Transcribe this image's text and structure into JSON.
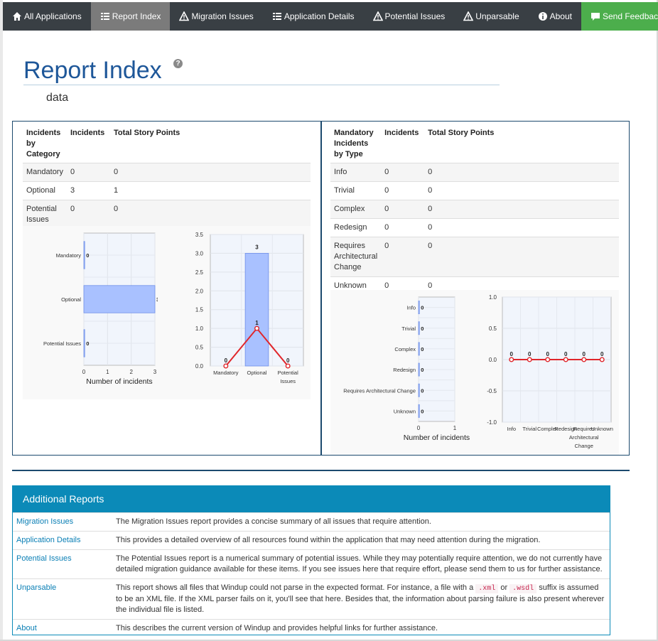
{
  "nav": {
    "items": [
      {
        "label": "All Applications",
        "icon": "home-icon"
      },
      {
        "label": "Report Index",
        "icon": "list-icon",
        "active": true
      },
      {
        "label": "Migration Issues",
        "icon": "warning-icon"
      },
      {
        "label": "Application Details",
        "icon": "list-icon"
      },
      {
        "label": "Potential Issues",
        "icon": "warning-icon"
      },
      {
        "label": "Unparsable",
        "icon": "warning-icon"
      },
      {
        "label": "About",
        "icon": "info-icon"
      }
    ],
    "feedback": {
      "label": "Send Feedback",
      "icon": "comment-icon"
    },
    "colors": {
      "bar": "#393f44",
      "active": "#7b7b7b",
      "feedback": "#4cae4c"
    }
  },
  "page": {
    "title": "Report Index",
    "help_glyph": "?",
    "app_name": "data",
    "title_color": "#1e5799"
  },
  "category_table": {
    "headers": [
      "Incidents by Category",
      "Incidents",
      "Total Story Points"
    ],
    "rows": [
      {
        "name": "Mandatory",
        "incidents": "0",
        "points": "0"
      },
      {
        "name": "Optional",
        "incidents": "3",
        "points": "1"
      },
      {
        "name": "Potential Issues",
        "incidents": "0",
        "points": "0"
      }
    ]
  },
  "type_table": {
    "headers": [
      "Mandatory Incidents by Type",
      "Incidents",
      "Total Story Points"
    ],
    "rows": [
      {
        "name": "Info",
        "incidents": "0",
        "points": "0"
      },
      {
        "name": "Trivial",
        "incidents": "0",
        "points": "0"
      },
      {
        "name": "Complex",
        "incidents": "0",
        "points": "0"
      },
      {
        "name": "Redesign",
        "incidents": "0",
        "points": "0"
      },
      {
        "name": "Requires Architectural Change",
        "incidents": "0",
        "points": "0"
      },
      {
        "name": "Unknown",
        "incidents": "0",
        "points": "0"
      }
    ]
  },
  "chart_data": [
    {
      "type": "bar",
      "orientation": "horizontal",
      "categories": [
        "Mandatory",
        "Optional",
        "Potential Issues"
      ],
      "values": [
        0,
        3,
        0
      ],
      "xlabel": "Number of incidents",
      "xlim": [
        0,
        3
      ],
      "xticks": [
        "0",
        "1",
        "2",
        "3"
      ],
      "bar_color": "#a9c1ff",
      "grid": true
    },
    {
      "type": "bar",
      "categories": [
        "Mandatory",
        "Optional",
        "Potential Issues"
      ],
      "values": [
        0,
        3,
        0
      ],
      "line_values": [
        0,
        1,
        0
      ],
      "ylim": [
        0,
        3.5
      ],
      "yticks": [
        "0.0",
        "0.5",
        "1.0",
        "1.5",
        "2.0",
        "2.5",
        "3.0",
        "3.5"
      ],
      "bar_color": "#a9c1ff",
      "line_color": "#e0262b",
      "grid": true
    },
    {
      "type": "bar",
      "orientation": "horizontal",
      "categories": [
        "Info",
        "Trivial",
        "Complex",
        "Redesign",
        "Requires Architectural Change",
        "Unknown"
      ],
      "values": [
        0,
        0,
        0,
        0,
        0,
        0
      ],
      "xlabel": "Number of incidents",
      "xlim": [
        0,
        1
      ],
      "xticks": [
        "0",
        "1"
      ],
      "bar_color": "#a9c1ff",
      "grid": true
    },
    {
      "type": "line",
      "categories": [
        "Info",
        "Trivial",
        "Complex",
        "Redesign",
        "Requires Architectural Change",
        "Unknown"
      ],
      "values": [
        0,
        0,
        0,
        0,
        0,
        0
      ],
      "line_values": [
        0,
        0,
        0,
        0,
        0,
        0
      ],
      "ylim": [
        -1,
        1
      ],
      "yticks": [
        "-1.0",
        "-0.5",
        "0.0",
        "0.5",
        "1.0"
      ],
      "line_color": "#e0262b",
      "grid": true
    }
  ],
  "additional": {
    "title": "Additional Reports",
    "rows": [
      {
        "link": "Migration Issues",
        "desc": "The Migration Issues report provides a concise summary of all issues that require attention."
      },
      {
        "link": "Application Details",
        "desc": "This provides a detailed overview of all resources found within the application that may need attention during the migration."
      },
      {
        "link": "Potential Issues",
        "desc": "The Potential Issues report is a numerical summary of potential issues. While they may potentially require attention, we do not currently have detailed migration guidance available for these items. If you see issues here that require effort, please send them to us for further assistance."
      },
      {
        "link": "Unparsable",
        "desc_parts": [
          "This report shows all files that Windup could not parse in the expected format. For instance, a file with a ",
          ".xml",
          " or ",
          ".wsdl",
          " suffix is assumed to be an XML file. If the XML parser fails on it, you'll see that here. Besides that, the information about parsing failure is also present wherever the individual file is listed."
        ]
      },
      {
        "link": "About",
        "desc": "This describes the current version of Windup and provides helpful links for further assistance."
      }
    ]
  }
}
